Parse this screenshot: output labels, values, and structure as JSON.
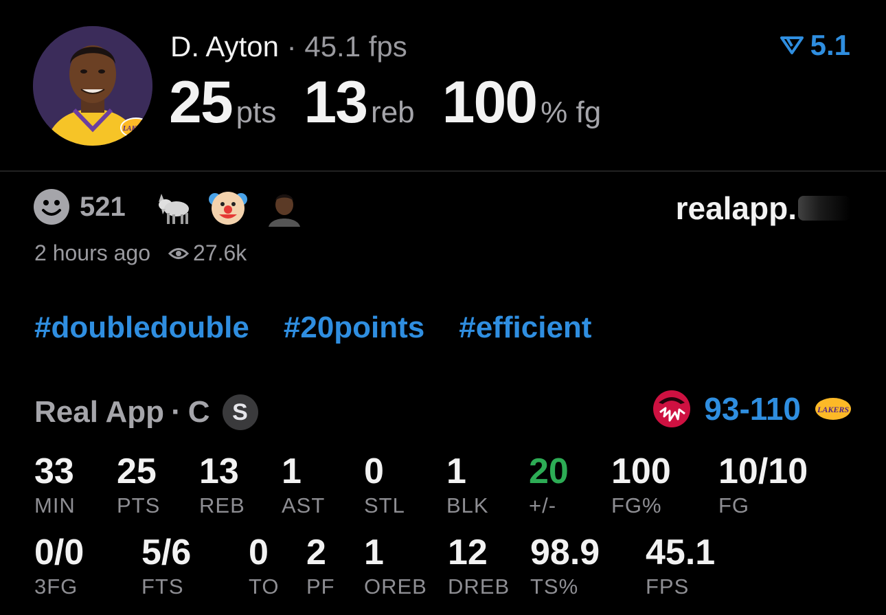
{
  "header": {
    "player_name": "D. Ayton",
    "separator": "·",
    "fps": "45.1 fps",
    "stats": [
      {
        "value": "25",
        "unit": "pts"
      },
      {
        "value": "13",
        "unit": "reb"
      },
      {
        "value": "100",
        "unit": "% fg"
      }
    ],
    "rating": "5.1",
    "rating_icon": "rating-chevron-icon"
  },
  "reactions": {
    "count": "521",
    "icons": [
      "smiley-icon",
      "goat-emoji",
      "clown-emoji",
      "user-avatar-emoji"
    ]
  },
  "brand": "realapp.",
  "meta": {
    "time": "2 hours ago",
    "views": "27.6k"
  },
  "hashtags": [
    "#doubledouble",
    "#20points",
    "#efficient"
  ],
  "game": {
    "source": "Real App",
    "separator": "·",
    "position": "C",
    "starter_badge": "S",
    "score": "93-110",
    "away_team_logo": "raptors-logo",
    "home_team_logo": "lakers-logo"
  },
  "box_score": {
    "row1": [
      {
        "value": "33",
        "label": "MIN"
      },
      {
        "value": "25",
        "label": "PTS"
      },
      {
        "value": "13",
        "label": "REB"
      },
      {
        "value": "1",
        "label": "AST"
      },
      {
        "value": "0",
        "label": "STL"
      },
      {
        "value": "1",
        "label": "BLK"
      },
      {
        "value": "20",
        "label": "+/-"
      },
      {
        "value": "100",
        "label": "FG%"
      },
      {
        "value": "10/10",
        "label": "FG"
      }
    ],
    "row2": [
      {
        "value": "0/0",
        "label": "3FG"
      },
      {
        "value": "5/6",
        "label": "FTS"
      },
      {
        "value": "0",
        "label": "TO"
      },
      {
        "value": "2",
        "label": "PF"
      },
      {
        "value": "1",
        "label": "OREB"
      },
      {
        "value": "12",
        "label": "DREB"
      },
      {
        "value": "98.9",
        "label": "TS%"
      },
      {
        "value": "45.1",
        "label": "FPS"
      }
    ]
  },
  "colors": {
    "accent_blue": "#2f8ee0",
    "positive_green": "#2dac55",
    "raptors_red": "#ce1141",
    "lakers_gold": "#fdb927",
    "lakers_purple": "#552583"
  }
}
